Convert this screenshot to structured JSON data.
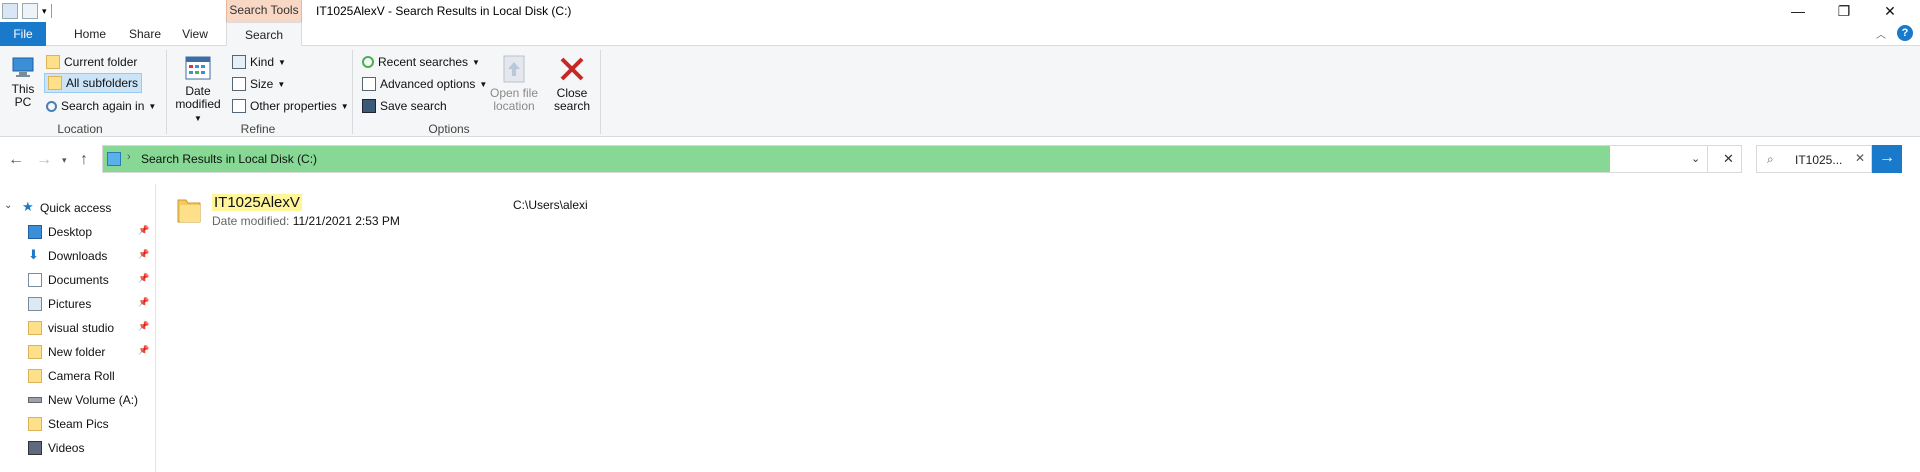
{
  "window": {
    "title": "IT1025AlexV - Search Results in Local Disk (C:)",
    "context_tab_group": "Search Tools",
    "controls": {
      "minimize": "—",
      "restore": "❐",
      "close": "✕"
    }
  },
  "tabs": {
    "file": "File",
    "home": "Home",
    "share": "Share",
    "view": "View",
    "search": "Search"
  },
  "ribbon": {
    "location": {
      "label": "Location",
      "this_pc": "This PC",
      "current_folder": "Current folder",
      "all_subfolders": "All subfolders",
      "search_again_in": "Search again in"
    },
    "refine": {
      "label": "Refine",
      "date_modified": "Date modified",
      "kind": "Kind",
      "size": "Size",
      "other_properties": "Other properties"
    },
    "options": {
      "label": "Options",
      "recent_searches": "Recent searches",
      "advanced_options": "Advanced options",
      "save_search": "Save search",
      "open_file_location": "Open file location",
      "close_search": "Close search"
    }
  },
  "address": {
    "path": "Search Results in Local Disk (C:)",
    "search_value": "IT1025..."
  },
  "navpane": {
    "quick_access": "Quick access",
    "items": [
      {
        "label": "Desktop",
        "icon": "desktop-icon",
        "pinned": true
      },
      {
        "label": "Downloads",
        "icon": "downloads-icon",
        "pinned": true
      },
      {
        "label": "Documents",
        "icon": "documents-icon",
        "pinned": true
      },
      {
        "label": "Pictures",
        "icon": "pictures-icon",
        "pinned": true
      },
      {
        "label": "visual studio",
        "icon": "folder-icon",
        "pinned": true
      },
      {
        "label": "New folder",
        "icon": "folder-icon",
        "pinned": true
      },
      {
        "label": "Camera Roll",
        "icon": "folder-icon",
        "pinned": false
      },
      {
        "label": "New Volume (A:)",
        "icon": "drive-icon",
        "pinned": false
      },
      {
        "label": "Steam Pics",
        "icon": "folder-icon",
        "pinned": false
      },
      {
        "label": "Videos",
        "icon": "videos-icon",
        "pinned": false
      }
    ]
  },
  "results": [
    {
      "name": "IT1025AlexV",
      "date_modified_label": "Date modified:",
      "date_modified": "11/21/2021 2:53 PM",
      "path": "C:\\Users\\alexi"
    }
  ],
  "colors": {
    "accent": "#1979ca",
    "search_tools_context": "#f8d7c4",
    "progress_fill": "#86d894",
    "highlight": "#fff59a"
  },
  "search_progress_fraction": 0.92
}
